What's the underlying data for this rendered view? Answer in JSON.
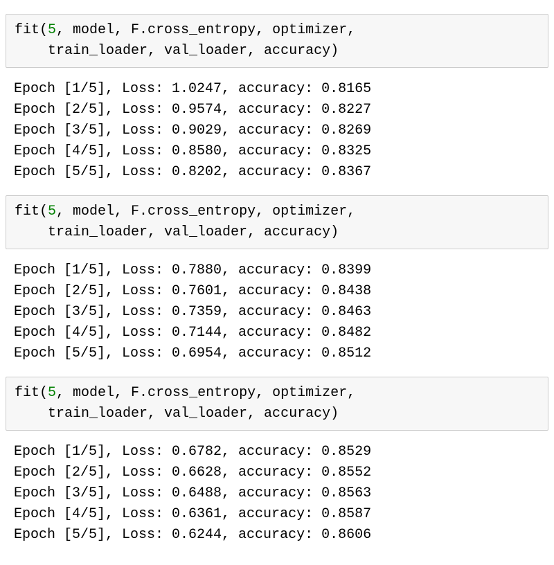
{
  "blocks": [
    {
      "code": {
        "prefix": "fit(",
        "number": "5",
        "rest1": ", model, F.cross_entropy, optimizer,",
        "line2": "    train_loader, val_loader, accuracy)"
      },
      "output": [
        "Epoch [1/5], Loss: 1.0247, accuracy: 0.8165",
        "Epoch [2/5], Loss: 0.9574, accuracy: 0.8227",
        "Epoch [3/5], Loss: 0.9029, accuracy: 0.8269",
        "Epoch [4/5], Loss: 0.8580, accuracy: 0.8325",
        "Epoch [5/5], Loss: 0.8202, accuracy: 0.8367"
      ]
    },
    {
      "code": {
        "prefix": "fit(",
        "number": "5",
        "rest1": ", model, F.cross_entropy, optimizer,",
        "line2": "    train_loader, val_loader, accuracy)"
      },
      "output": [
        "Epoch [1/5], Loss: 0.7880, accuracy: 0.8399",
        "Epoch [2/5], Loss: 0.7601, accuracy: 0.8438",
        "Epoch [3/5], Loss: 0.7359, accuracy: 0.8463",
        "Epoch [4/5], Loss: 0.7144, accuracy: 0.8482",
        "Epoch [5/5], Loss: 0.6954, accuracy: 0.8512"
      ]
    },
    {
      "code": {
        "prefix": "fit(",
        "number": "5",
        "rest1": ", model, F.cross_entropy, optimizer,",
        "line2": "    train_loader, val_loader, accuracy)"
      },
      "output": [
        "Epoch [1/5], Loss: 0.6782, accuracy: 0.8529",
        "Epoch [2/5], Loss: 0.6628, accuracy: 0.8552",
        "Epoch [3/5], Loss: 0.6488, accuracy: 0.8563",
        "Epoch [4/5], Loss: 0.6361, accuracy: 0.8587",
        "Epoch [5/5], Loss: 0.6244, accuracy: 0.8606"
      ]
    }
  ]
}
